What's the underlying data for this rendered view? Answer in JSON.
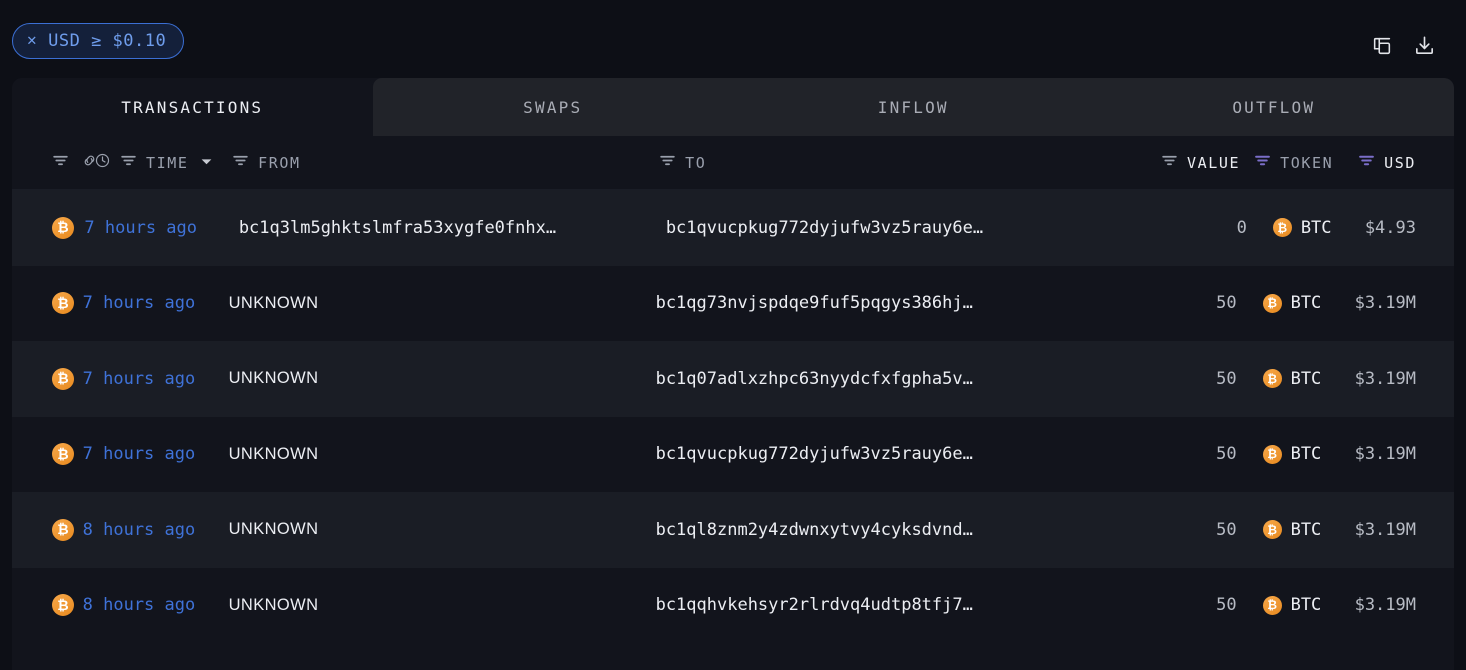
{
  "topbar": {
    "filter_chip": {
      "remove_icon": "close-icon",
      "label": "USD ≥ $0.10"
    },
    "actions": [
      {
        "name": "copy-icon",
        "label": "Copy"
      },
      {
        "name": "download-icon",
        "label": "Download"
      }
    ]
  },
  "tabs": [
    {
      "label": "TRANSACTIONS",
      "active": true
    },
    {
      "label": "SWAPS",
      "active": false
    },
    {
      "label": "INFLOW",
      "active": false
    },
    {
      "label": "OUTFLOW",
      "active": false
    }
  ],
  "table": {
    "headers": {
      "chain_filter_icon": "filter-icon",
      "chain_icon": "link-icon",
      "time_clock_icon": "clock-icon",
      "time": "TIME",
      "time_sort": "▼",
      "from": "FROM",
      "to": "TO",
      "value": "VALUE",
      "token": "TOKEN",
      "usd": "USD"
    },
    "rows": [
      {
        "chain_icon": "bitcoin-icon",
        "time": "7 hours ago",
        "from": "bc1q3lm5ghktslmfra53xygfe0fnhx…",
        "from_unknown": false,
        "to": "bc1qvucpkug772dyjufw3vz5rauy6e…",
        "value": "0",
        "token": "BTC",
        "usd": "$4.93"
      },
      {
        "chain_icon": "bitcoin-icon",
        "time": "7 hours ago",
        "from": "UNKNOWN",
        "from_unknown": true,
        "to": "bc1qg73nvjspdqe9fuf5pqgys386hj…",
        "value": "50",
        "token": "BTC",
        "usd": "$3.19M"
      },
      {
        "chain_icon": "bitcoin-icon",
        "time": "7 hours ago",
        "from": "UNKNOWN",
        "from_unknown": true,
        "to": "bc1q07adlxzhpc63nyydcfxfgpha5v…",
        "value": "50",
        "token": "BTC",
        "usd": "$3.19M"
      },
      {
        "chain_icon": "bitcoin-icon",
        "time": "7 hours ago",
        "from": "UNKNOWN",
        "from_unknown": true,
        "to": "bc1qvucpkug772dyjufw3vz5rauy6e…",
        "value": "50",
        "token": "BTC",
        "usd": "$3.19M"
      },
      {
        "chain_icon": "bitcoin-icon",
        "time": "8 hours ago",
        "from": "UNKNOWN",
        "from_unknown": true,
        "to": "bc1ql8znm2y4zdwnxytvy4cyksdvnd…",
        "value": "50",
        "token": "BTC",
        "usd": "$3.19M"
      },
      {
        "chain_icon": "bitcoin-icon",
        "time": "8 hours ago",
        "from": "UNKNOWN",
        "from_unknown": true,
        "to": "bc1qqhvkehsyr2rlrdvq4udtp8tfj7…",
        "value": "50",
        "token": "BTC",
        "usd": "$3.19M"
      }
    ]
  },
  "colors": {
    "page_background": "#0d0f16",
    "panel_background": "#12141c",
    "row_alt_background": "#1a1d25",
    "tab_inactive_background": "#212329",
    "accent_blue": "#3f72d8",
    "chip_border": "#3b6fd4",
    "chip_text": "#6f9dec",
    "bitcoin_orange": "#f0931f",
    "filter_active_purple": "#7b6ec9",
    "text_primary": "#eceef3",
    "text_muted": "#9aa0ad"
  }
}
